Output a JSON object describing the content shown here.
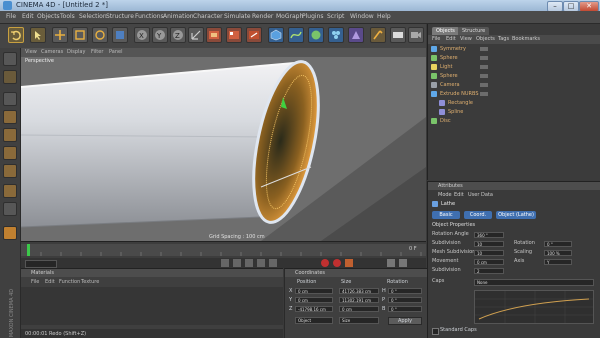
{
  "window": {
    "title": "CINEMA 4D - [Untitled 2 *]"
  },
  "menu": [
    "File",
    "Edit",
    "Objects",
    "Tools",
    "Selection",
    "Structure",
    "Functions",
    "Animation",
    "Character",
    "Simulate",
    "Render",
    "MoGraph",
    "Plugins",
    "Script",
    "Window",
    "Help"
  ],
  "toolbar": {
    "icons": [
      "undo-icon",
      "redo-icon",
      "live-select-icon",
      "move-icon",
      "scale-icon",
      "rotate-icon",
      "x-axis-icon",
      "y-axis-icon",
      "z-axis-icon",
      "coord-system-icon",
      "render-view-icon",
      "render-picture-viewer-icon",
      "edit-render-settings-icon",
      "cube-icon",
      "spline-icon",
      "nurbs-icon",
      "array-icon",
      "deformer-icon",
      "scene-icon",
      "light-icon",
      "camera-icon"
    ]
  },
  "viewport": {
    "menu": [
      "View",
      "Cameras",
      "Display",
      "Filter",
      "Panel"
    ],
    "label": "Perspective",
    "grid_label": "Grid Spacing : 100 cm"
  },
  "timeline": {
    "start": "0",
    "end": "90 F",
    "current": "0 F"
  },
  "materials": {
    "title": "Materials",
    "menu": [
      "File",
      "Edit",
      "Function",
      "Texture"
    ]
  },
  "coordinates": {
    "title": "Coordinates",
    "headers": [
      "Position",
      "Size",
      "Rotation"
    ],
    "rows": [
      {
        "axis": "X",
        "pos": "0 cm",
        "size": "41726.383 cm",
        "rot_label": "H",
        "rot": "0 °"
      },
      {
        "axis": "Y",
        "pos": "0 cm",
        "size": "11302.191 cm",
        "rot_label": "P",
        "rot": "0 °"
      },
      {
        "axis": "Z",
        "pos": "-41798.16 cm",
        "size": "0 cm",
        "rot_label": "B",
        "rot": "0 °"
      }
    ],
    "mode": "Object",
    "size_mode": "Size",
    "apply": "Apply"
  },
  "status": "00:00:01   Redo (Shift+Z)",
  "object_manager": {
    "tabs": [
      "Objects",
      "Structure"
    ],
    "menu": [
      "File",
      "Edit",
      "View",
      "Objects",
      "Tags",
      "Bookmarks"
    ],
    "objects": [
      {
        "name": "Symmetry",
        "color": "#5fa8e8"
      },
      {
        "name": "Sphere",
        "color": "#7ac46a"
      },
      {
        "name": "Light",
        "color": "#e8d35f"
      },
      {
        "name": "Sphere",
        "color": "#7ac46a"
      },
      {
        "name": "Camera",
        "color": "#9aa0a8"
      },
      {
        "name": "Extrude NURBS",
        "color": "#5fa8e8"
      },
      {
        "name": "Rectangle",
        "color": "#8f8fd8"
      },
      {
        "name": "Spline",
        "color": "#8f8fd8"
      },
      {
        "name": "Disc",
        "color": "#7ac46a"
      }
    ]
  },
  "attributes": {
    "title": "Attributes",
    "menu": [
      "Mode",
      "Edit",
      "User Data"
    ],
    "object_name": "Lathe",
    "tabs": [
      "Basic",
      "Coord.",
      "Object (Lathe)"
    ],
    "section": "Object Properties",
    "rows": [
      {
        "label": "Rotation Angle",
        "value": "360 °"
      },
      {
        "label": "Subdivision",
        "value": "10"
      },
      {
        "label": "Mesh Subdivision",
        "value": "10"
      },
      {
        "label": "Movement",
        "value": "0 cm"
      },
      {
        "label": "Subdivision",
        "value": "2"
      }
    ],
    "extra_rows": [
      {
        "label": "Rotation",
        "value": "0 °"
      },
      {
        "label": "Scaling",
        "value": "100 %"
      },
      {
        "label": "Axis",
        "value": "Y"
      }
    ],
    "caps": "Caps",
    "dropdown": "None",
    "checkbox_label": "Standard Caps",
    "accent": "#3f6fb0"
  },
  "brand": "MAXON CINEMA 4D"
}
